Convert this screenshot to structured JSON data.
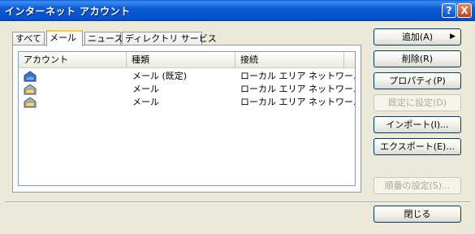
{
  "window": {
    "title": "インターネット アカウント"
  },
  "tabs": [
    {
      "label": "すべて"
    },
    {
      "label": "メール"
    },
    {
      "label": "ニュース"
    },
    {
      "label": "ディレクトリ サービス"
    }
  ],
  "list": {
    "columns": [
      "アカウント",
      "種類",
      "接続"
    ],
    "rows": [
      {
        "account": "",
        "type": "メール (既定)",
        "connection": "ローカル エリア ネットワー..."
      },
      {
        "account": "",
        "type": "メール",
        "connection": "ローカル エリア ネットワー..."
      },
      {
        "account": "",
        "type": "メール",
        "connection": "ローカル エリア ネットワー..."
      }
    ]
  },
  "buttons": {
    "add": "追加(A)",
    "remove": "削除(R)",
    "properties": "プロパティ(P)",
    "set_default": "既定に設定(D)",
    "import": "インポート(I)...",
    "export": "エクスポート(E)...",
    "order": "順番の設定(S)...",
    "close": "閉じる"
  },
  "icons": {
    "help": "?",
    "close": "X",
    "submenu_arrow": "▶"
  }
}
